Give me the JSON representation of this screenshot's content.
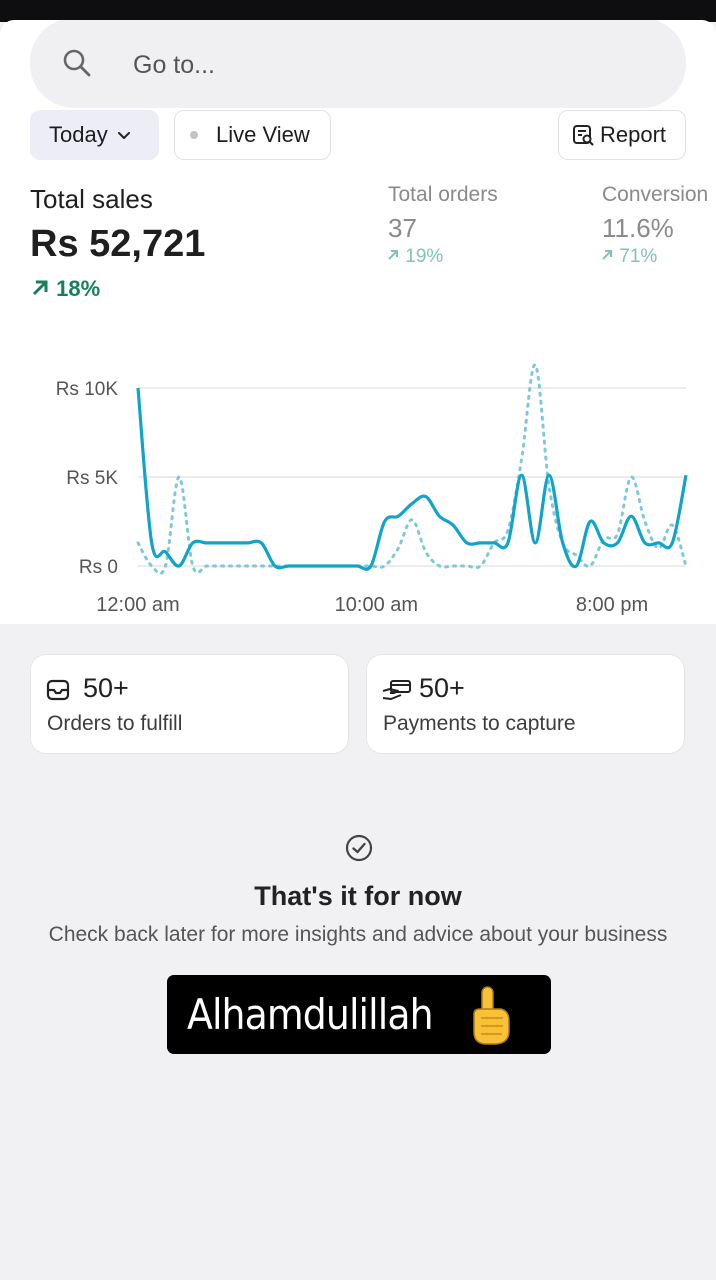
{
  "search": {
    "placeholder": "Go to..."
  },
  "filters": {
    "date_label": "Today",
    "live_label": "Live View",
    "report_label": "Report"
  },
  "metrics": {
    "total_sales": {
      "label": "Total sales",
      "value": "Rs 52,721",
      "change": "18%"
    },
    "total_orders": {
      "label": "Total orders",
      "value": "37",
      "change": "19%"
    },
    "conversion": {
      "label": "Conversion",
      "value": "11.6%",
      "change": "71%"
    }
  },
  "chart_data": {
    "type": "line",
    "y_tick_labels": [
      "Rs 10K",
      "Rs 5K",
      "Rs 0"
    ],
    "x_tick_labels": [
      "12:00 am",
      "10:00 am",
      "8:00 pm"
    ],
    "ylim": [
      0,
      10000
    ],
    "grid": true,
    "colors": {
      "current": "#12a3c9",
      "previous": "#7fc8dc"
    },
    "series": [
      {
        "style": "solid",
        "values": [
          10000,
          1300,
          800,
          0,
          1300,
          1300,
          1300,
          1300,
          1300,
          1300,
          0,
          0,
          0,
          0,
          0,
          0,
          0,
          0,
          2500,
          2800,
          3500,
          3900,
          2800,
          2300,
          1300,
          1300,
          1300,
          1300,
          5100,
          1300,
          5100,
          1300,
          0,
          2500,
          1300,
          1300,
          2800,
          1300,
          1300,
          1300,
          5100
        ]
      },
      {
        "style": "dotted",
        "values": [
          1300,
          0,
          0,
          5000,
          0,
          0,
          0,
          0,
          0,
          0,
          0,
          0,
          0,
          0,
          0,
          0,
          0,
          0,
          0,
          1000,
          2600,
          800,
          0,
          0,
          0,
          0,
          1300,
          2000,
          6000,
          11300,
          4500,
          1300,
          600,
          0,
          1500,
          1800,
          5000,
          2500,
          1000,
          2300,
          0
        ]
      }
    ]
  },
  "tasks": [
    {
      "icon": "inbox-icon",
      "count": "50+",
      "label": "Orders to fulfill"
    },
    {
      "icon": "payment-hand-icon",
      "count": "50+",
      "label": "Payments to capture"
    }
  ],
  "empty_state": {
    "title": "That's it for now",
    "text": "Check back later for more insights and advice about your business"
  },
  "sticker": {
    "text": "Alhamdulillah",
    "emoji": "index-pointing-up-emoji"
  }
}
